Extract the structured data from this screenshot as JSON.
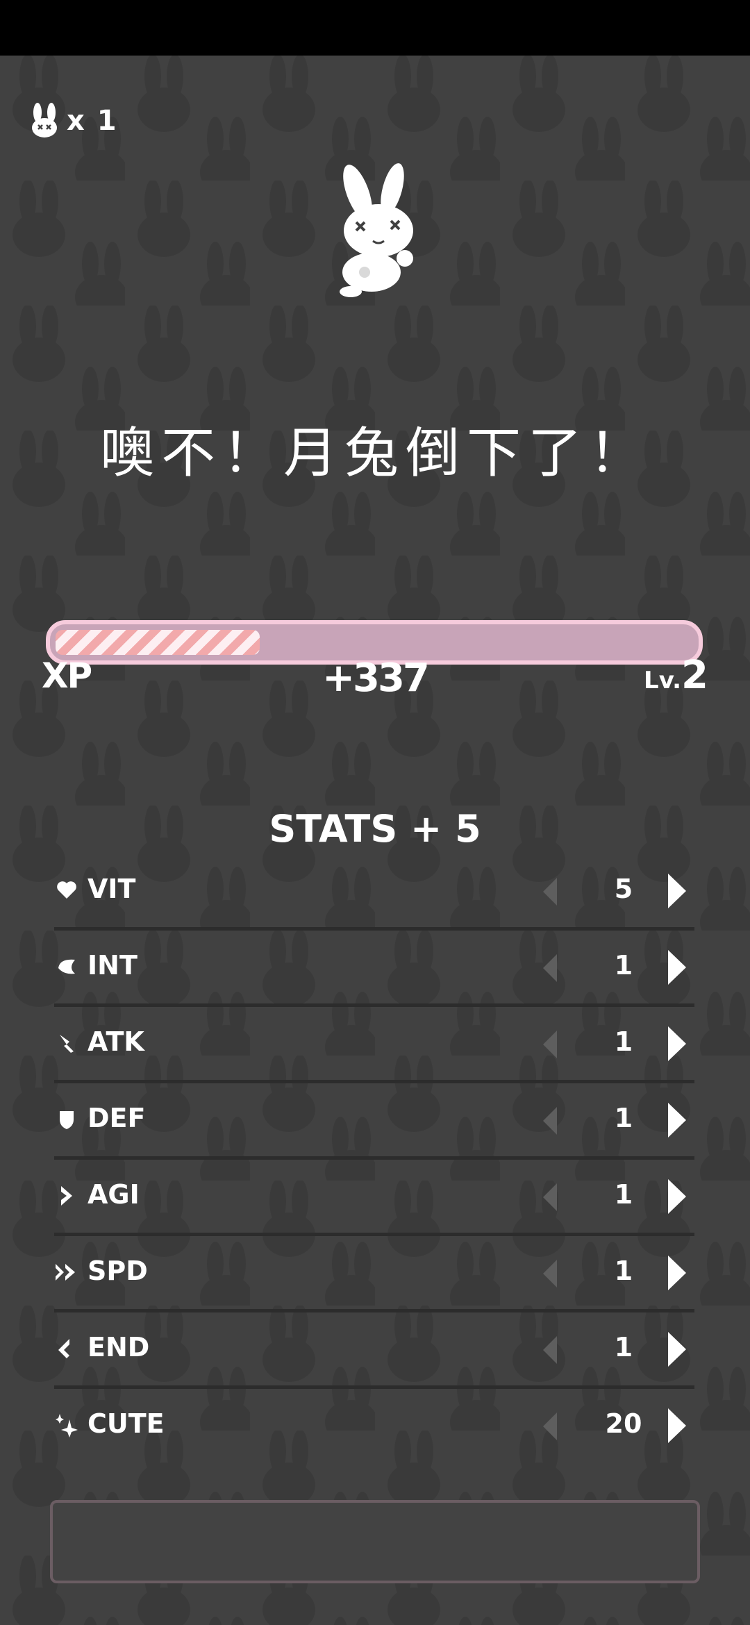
{
  "lives": {
    "icon": "bunny-icon",
    "count_text": "x 1"
  },
  "title": "噢不！月兔倒下了！",
  "xp": {
    "label": "XP",
    "gain": "+337",
    "level_prefix": "Lv.",
    "level": "2",
    "progress": 0.32,
    "colors": {
      "track": "#c8a4b8",
      "border": "#f6cbdc",
      "stripe_a": "#f2a9ab",
      "stripe_b": "#fdeff2"
    }
  },
  "stats_title": "STATS + 5",
  "stats": [
    {
      "icon": "heart-icon",
      "name": "VIT",
      "value": "5"
    },
    {
      "icon": "brain-icon",
      "name": "INT",
      "value": "1"
    },
    {
      "icon": "sword-icon",
      "name": "ATK",
      "value": "1"
    },
    {
      "icon": "shield-icon",
      "name": "DEF",
      "value": "1"
    },
    {
      "icon": "chevron-icon",
      "name": "AGI",
      "value": "1"
    },
    {
      "icon": "double-chevron-icon",
      "name": "SPD",
      "value": "1"
    },
    {
      "icon": "stamina-icon",
      "name": "END",
      "value": "1"
    },
    {
      "icon": "sparkle-icon",
      "name": "CUTE",
      "value": "20"
    }
  ]
}
